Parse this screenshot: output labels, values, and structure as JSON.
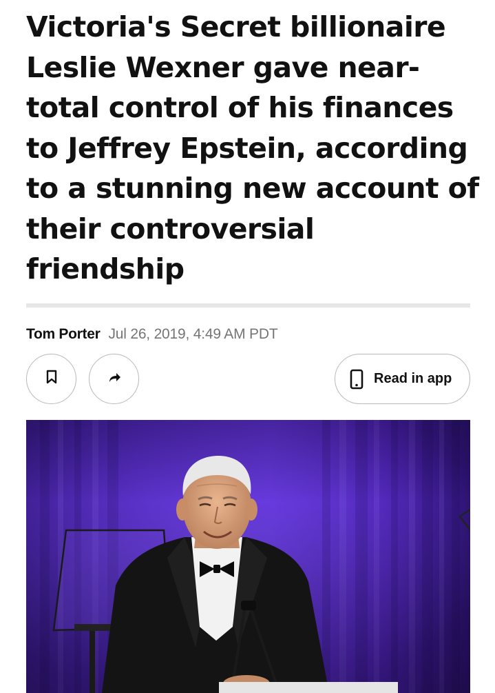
{
  "article": {
    "headline": "Victoria's Secret billionaire Leslie Wexner gave near-total control of his finances to Jeffrey Epstein, according to a stunning new account of their controversial friendship",
    "author": "Tom Porter",
    "date": "Jul 26, 2019, 4:49 AM PDT"
  },
  "actions": {
    "bookmark_icon": "bookmark-icon",
    "share_icon": "share-arrow-icon",
    "read_in_app_icon": "phone-icon",
    "read_in_app_label": "Read in app"
  },
  "hero_image": {
    "subject": "man-in-tuxedo-at-podium-icon"
  },
  "colors": {
    "text": "#111111",
    "muted": "#757575",
    "border": "#b8b8b8",
    "rule": "#e6e6e6",
    "stage_purple": "#4a1fb0"
  }
}
